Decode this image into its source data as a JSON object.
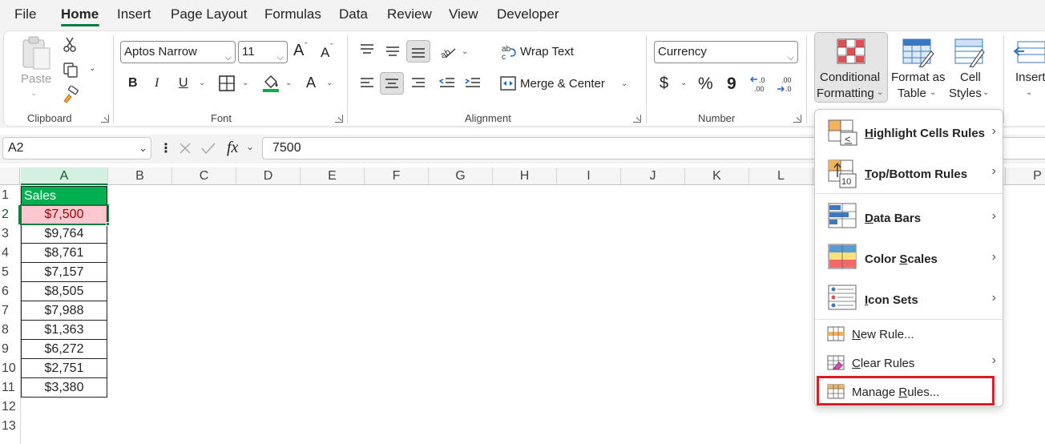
{
  "tabs": [
    "File",
    "Home",
    "Insert",
    "Page Layout",
    "Formulas",
    "Data",
    "Review",
    "View",
    "Developer"
  ],
  "ribbon": {
    "clipboard": {
      "paste": "Paste",
      "label": "Clipboard"
    },
    "font": {
      "family": "Aptos Narrow",
      "size": "11",
      "bold": "B",
      "italic": "I",
      "underline": "U",
      "grow": "A",
      "shrink": "A",
      "font_color": "A",
      "label": "Font"
    },
    "alignment": {
      "wrap_text": "Wrap Text",
      "merge_center": "Merge & Center",
      "label": "Alignment"
    },
    "number": {
      "format": "Currency",
      "dollar": "$",
      "percent": "%",
      "comma": "9",
      "inc_dec": "←.0\n.00",
      "dec_dec": ".00\n→.0",
      "label": "Number"
    },
    "styles": {
      "conditional_formatting_line1": "Conditional",
      "conditional_formatting_line2": "Formatting",
      "format_table_line1": "Format as",
      "format_table_line2": "Table",
      "cell_styles_line1": "Cell",
      "cell_styles_line2": "Styles"
    },
    "cells": {
      "insert": "Insert"
    }
  },
  "formula_bar": {
    "name_box": "A2",
    "fx": "fx",
    "formula": "7500"
  },
  "grid": {
    "columns": [
      "A",
      "B",
      "C",
      "D",
      "E",
      "F",
      "G",
      "H",
      "I",
      "J",
      "K",
      "L",
      "P"
    ],
    "rows": [
      "1",
      "2",
      "3",
      "4",
      "5",
      "6",
      "7",
      "8",
      "9",
      "10",
      "11",
      "12",
      "13"
    ],
    "header": "Sales",
    "values": [
      "$7,500",
      "$9,764",
      "$8,761",
      "$7,157",
      "$8,505",
      "$7,988",
      "$1,363",
      "$6,272",
      "$2,751",
      "$3,380"
    ]
  },
  "menu": {
    "highlight": {
      "pre": "",
      "key": "H",
      "post": "ighlight Cells Rules"
    },
    "topbottom": {
      "pre": "",
      "key": "T",
      "post": "op/Bottom Rules"
    },
    "databars": {
      "pre": "",
      "key": "D",
      "post": "ata Bars"
    },
    "colorscales": {
      "pre": "Color ",
      "key": "S",
      "post": "cales"
    },
    "iconsets": {
      "pre": "",
      "key": "I",
      "post": "con Sets"
    },
    "newrule": {
      "pre": "",
      "key": "N",
      "post": "ew Rule..."
    },
    "clearrules": {
      "pre": "",
      "key": "C",
      "post": "lear Rules"
    },
    "managerules": {
      "pre": "Manage ",
      "key": "R",
      "post": "ules..."
    },
    "icon_10": "10"
  },
  "colors": {
    "accent": "#107c41",
    "header_fill": "#00b050",
    "highlight_fill": "#ffc7ce",
    "highlight_text": "#9c0006",
    "callout": "#e01b24"
  }
}
